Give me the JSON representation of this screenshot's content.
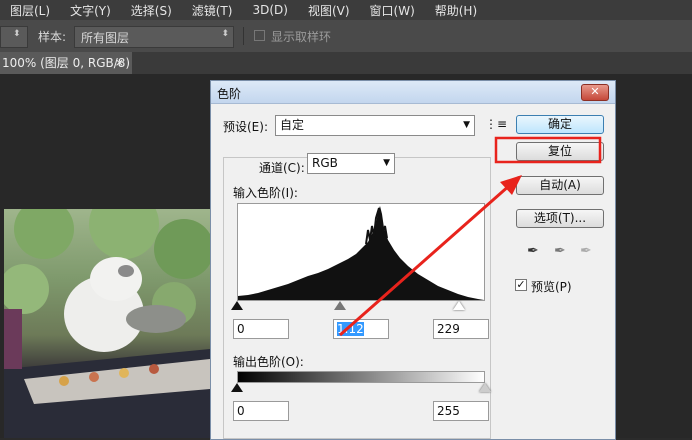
{
  "menubar": {
    "items": [
      "图层(L)",
      "文字(Y)",
      "选择(S)",
      "滤镜(T)",
      "3D(D)",
      "视图(V)",
      "窗口(W)",
      "帮助(H)"
    ]
  },
  "options": {
    "sample_label": "样本:",
    "sample_value": "所有图层",
    "show_ring_label": "显示取样环"
  },
  "doc_tab": {
    "label": "100% (图层 0, RGB/8)",
    "close": "×"
  },
  "dialog": {
    "title": "色阶",
    "close_glyph": "✕",
    "preset_label": "预设(E):",
    "preset_value": "自定",
    "channel_label": "通道(C):",
    "channel_value": "RGB",
    "input_levels_label": "输入色阶(I):",
    "input_black": "0",
    "input_gamma": "1.12",
    "input_white": "229",
    "output_levels_label": "输出色阶(O):",
    "output_black": "0",
    "output_white": "255",
    "buttons": {
      "ok": "确定",
      "reset": "复位",
      "auto": "自动(A)",
      "options": "选项(T)..."
    },
    "preview_label": "预览(P)",
    "preview_checked": true
  },
  "annotation": {
    "highlight_color": "#e8231c"
  }
}
